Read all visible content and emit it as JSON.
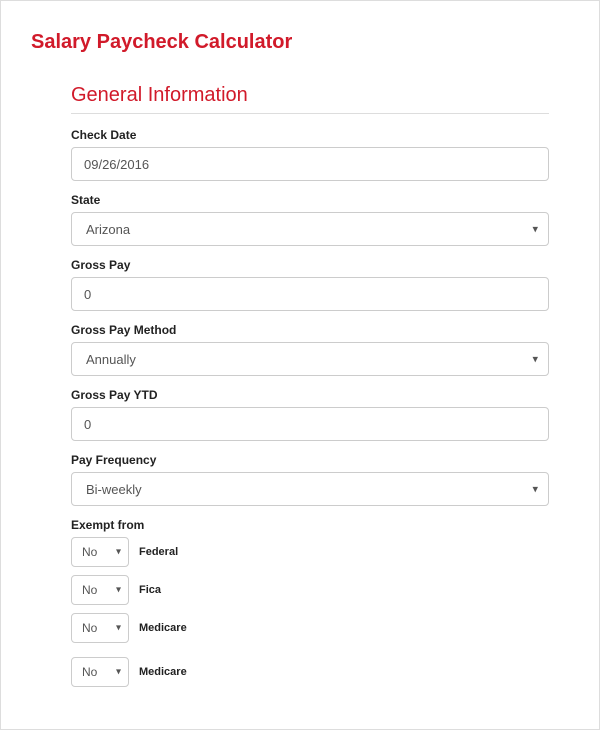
{
  "page_title": "Salary Paycheck Calculator",
  "section_title": "General Information",
  "fields": {
    "check_date": {
      "label": "Check Date",
      "value": "09/26/2016"
    },
    "state": {
      "label": "State",
      "value": "Arizona"
    },
    "gross_pay": {
      "label": "Gross Pay",
      "value": "0"
    },
    "gross_pay_method": {
      "label": "Gross Pay Method",
      "value": "Annually"
    },
    "gross_pay_ytd": {
      "label": "Gross Pay YTD",
      "value": "0"
    },
    "pay_frequency": {
      "label": "Pay Frequency",
      "value": "Bi-weekly"
    }
  },
  "exempt": {
    "label": "Exempt from",
    "rows": [
      {
        "value": "No",
        "label": "Federal"
      },
      {
        "value": "No",
        "label": "Fica"
      },
      {
        "value": "No",
        "label": "Medicare"
      },
      {
        "value": "No",
        "label": "Medicare"
      }
    ]
  }
}
